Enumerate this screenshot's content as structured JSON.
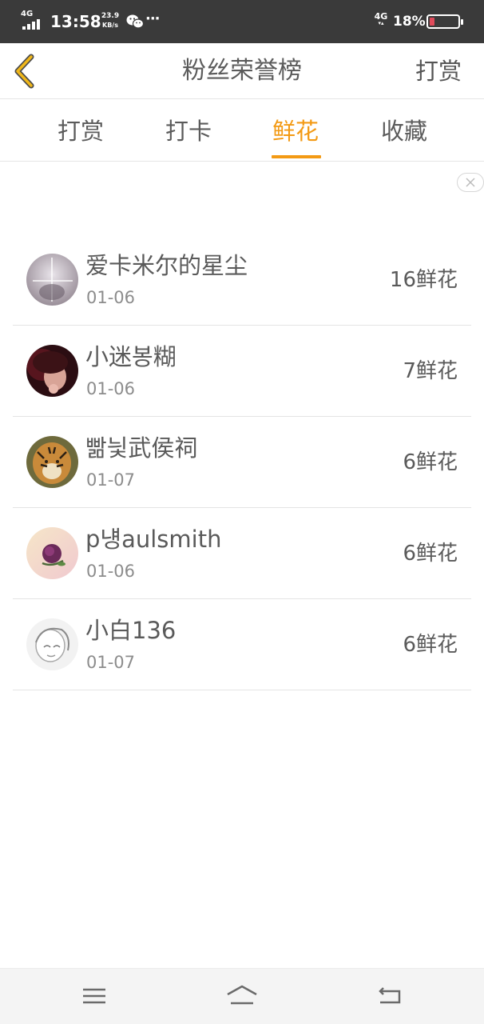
{
  "status_bar": {
    "network": "4G",
    "time": "13:58",
    "speed_value": "23.9",
    "speed_unit": "KB/s",
    "more": "···",
    "network_right": "4G",
    "battery": "18%",
    "battery_color": "#e04b5b"
  },
  "nav": {
    "title": "粉丝荣誉榜",
    "action": "打赏",
    "back_icon": "chevron-left-icon"
  },
  "tabs": [
    {
      "label": "打赏",
      "active": false
    },
    {
      "label": "打卡",
      "active": false
    },
    {
      "label": "鲜花",
      "active": true
    },
    {
      "label": "收藏",
      "active": false
    }
  ],
  "accent_color": "#f39a14",
  "fans": [
    {
      "name": "爱卡米尔的星尘",
      "date": "01-06",
      "count": "16鲜花"
    },
    {
      "name": "小迷봉糊",
      "date": "01-06",
      "count": "7鲜花"
    },
    {
      "name": "빪닃武侯祠",
      "date": "01-07",
      "count": "6鲜花"
    },
    {
      "name": "p넁aulsmith",
      "date": "01-06",
      "count": "6鲜花"
    },
    {
      "name": "小白136",
      "date": "01-07",
      "count": "6鲜花"
    }
  ],
  "system_nav": {
    "menu_icon": "menu-icon",
    "home_icon": "home-icon",
    "back_icon": "back-arrow-icon"
  }
}
